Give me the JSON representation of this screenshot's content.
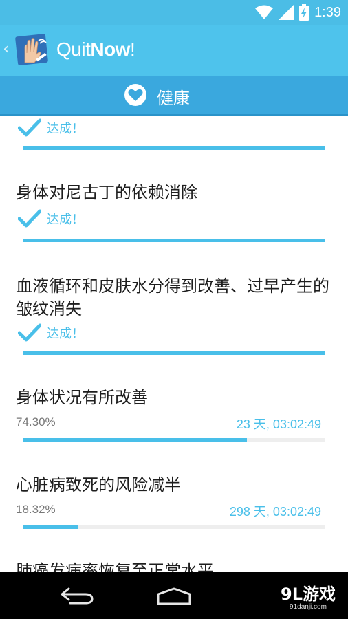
{
  "status_bar": {
    "time": "1:39"
  },
  "app_bar": {
    "title_light": "Quit",
    "title_bold": "Now",
    "title_end": "!"
  },
  "section": {
    "title": "健康"
  },
  "items": [
    {
      "title": "",
      "status": "达成！",
      "progress": 1.0
    },
    {
      "title": "身体对尼古丁的依赖消除",
      "status": "达成！",
      "progress": 1.0
    },
    {
      "title": "血液循环和皮肤水分得到改善、过早产生的皱纹消失",
      "status": "达成！",
      "progress": 1.0
    },
    {
      "title": "身体状况有所改善",
      "percent": "74.30%",
      "remaining": "23 天, 03:02:49",
      "progress": 0.743
    },
    {
      "title": "心脏病致死的风险减半",
      "percent": "18.32%",
      "remaining": "298 天, 03:02:49",
      "progress": 0.1832
    },
    {
      "title": "肺癌发病率恢复至正常水平"
    }
  ],
  "watermark": {
    "main": "9L游戏",
    "sub": "91danji.com"
  },
  "colors": {
    "accent": "#49bfe9",
    "app_bar": "#4ec3ec",
    "section_bar": "#3aa8de"
  }
}
